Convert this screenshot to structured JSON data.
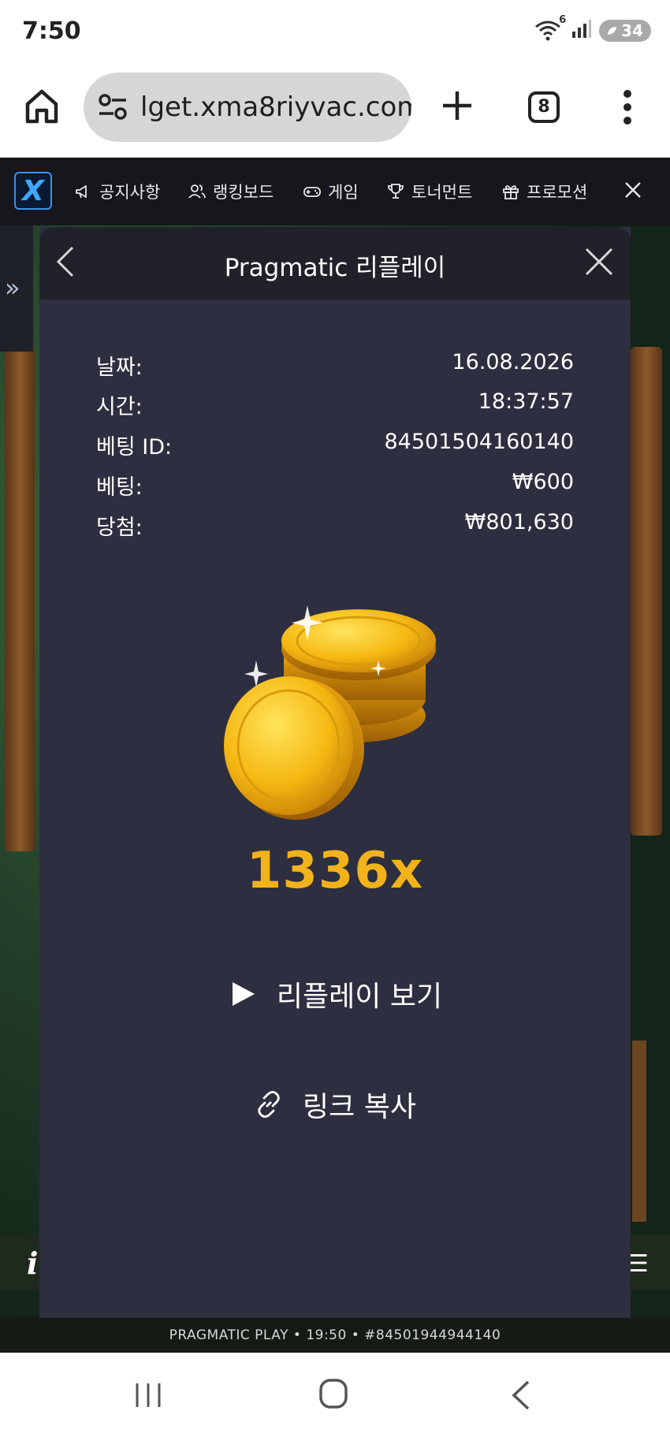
{
  "status_bar": {
    "time": "7:50",
    "wifi_badge": "6",
    "battery": "34",
    "icons": [
      "wifi-icon",
      "signal-icon",
      "battery-icon"
    ]
  },
  "browser": {
    "url": "lget.xma8riyvac.com",
    "tab_count": "8"
  },
  "site_nav": {
    "logo": "X",
    "items": [
      {
        "label": "공지사항",
        "icon": "megaphone-icon"
      },
      {
        "label": "랭킹보드",
        "icon": "users-icon"
      },
      {
        "label": "게임",
        "icon": "gamepad-icon"
      },
      {
        "label": "토너먼트",
        "icon": "trophy-icon"
      },
      {
        "label": "프로모션",
        "icon": "gift-icon"
      }
    ]
  },
  "modal": {
    "title": "Pragmatic 리플레이",
    "details": [
      {
        "label": "날짜:",
        "value": "16.08.2026"
      },
      {
        "label": "시간:",
        "value": "18:37:57"
      },
      {
        "label": "베팅 ID:",
        "value": "84501504160140"
      },
      {
        "label": "베팅:",
        "value": "₩600"
      },
      {
        "label": "당첨:",
        "value": "₩801,630"
      }
    ],
    "multiplier": "1336x",
    "watch_replay": "리플레이 보기",
    "copy_link": "링크 복사"
  },
  "game": {
    "provider_line": "PRAGMATIC PLAY • 19:50 • #84501944944140"
  },
  "colors": {
    "modal_bg": "#2d2e3f",
    "header_bg": "#202129",
    "nav_bg": "#16171c",
    "gold": "#f2b31a"
  }
}
